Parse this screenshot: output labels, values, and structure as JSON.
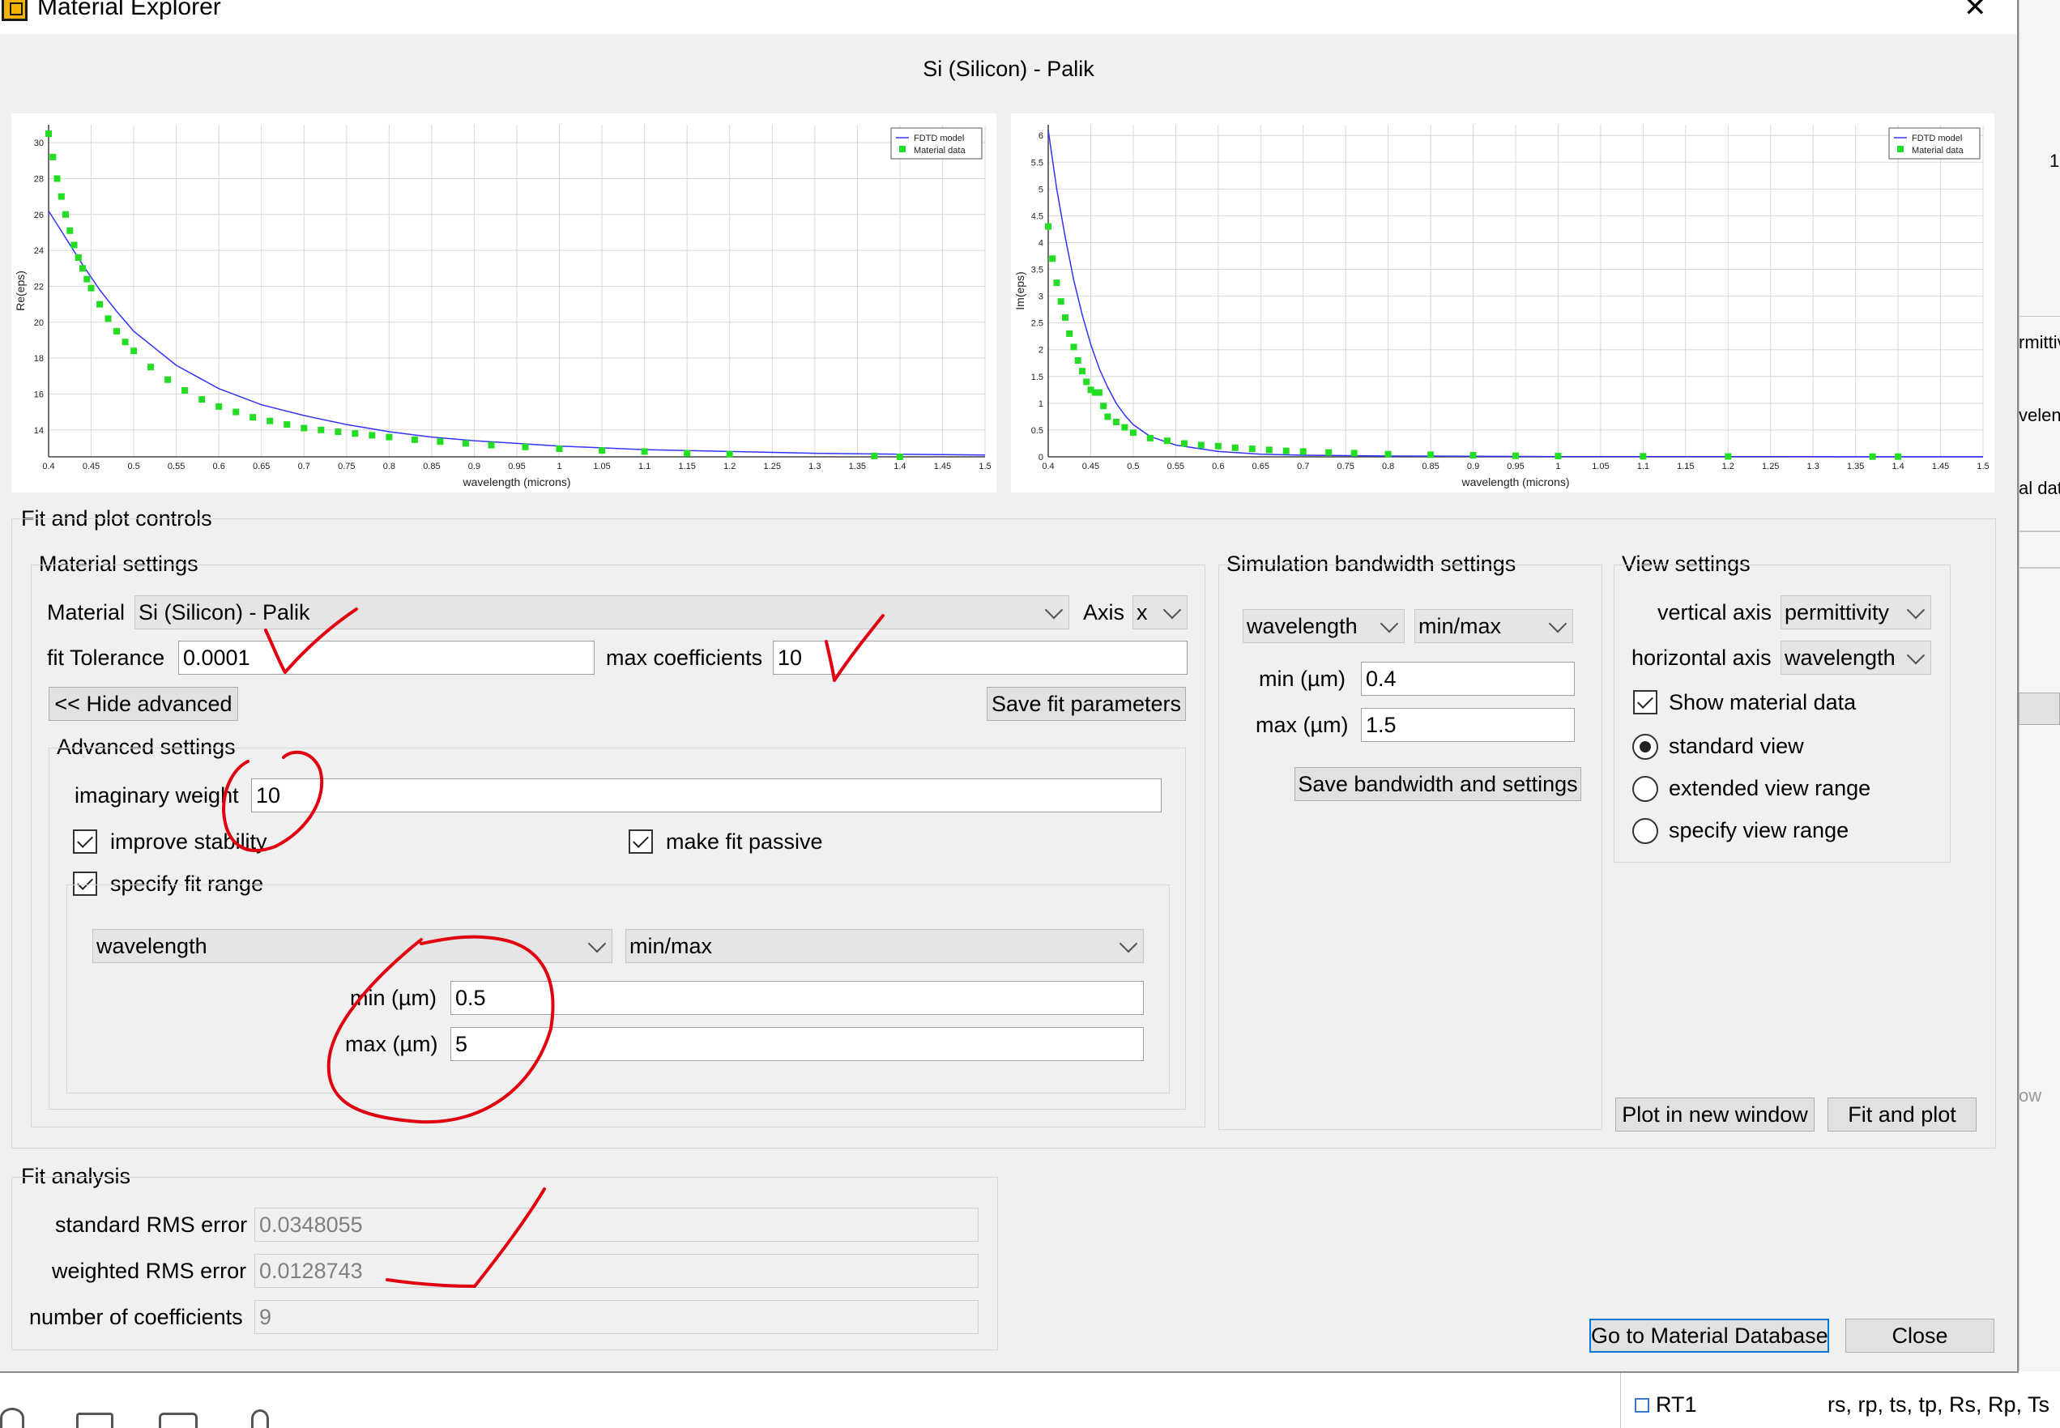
{
  "window": {
    "title": "Material Explorer",
    "close_glyph": "✕",
    "icon": "app-icon"
  },
  "plot_header": "Si (Silicon) - Palik",
  "charts": {
    "left": {
      "ylabel": "Re(eps)",
      "xlabel": "wavelength (microns)",
      "legend": [
        "FDTD model",
        "Material data"
      ],
      "yticks": [
        "14",
        "16",
        "18",
        "20",
        "22",
        "24",
        "26",
        "28",
        "30"
      ]
    },
    "right": {
      "ylabel": "Im(eps)",
      "xlabel": "wavelength (microns)",
      "legend": [
        "FDTD model",
        "Material data"
      ],
      "yticks": [
        "0",
        "0.5",
        "1",
        "1.5",
        "2",
        "2.5",
        "3",
        "3.5",
        "4",
        "4.5",
        "5",
        "5.5",
        "6"
      ]
    },
    "xticks": [
      "0.4",
      "0.45",
      "0.5",
      "0.55",
      "0.6",
      "0.65",
      "0.7",
      "0.75",
      "0.8",
      "0.85",
      "0.9",
      "0.95",
      "1",
      "1.05",
      "1.1",
      "1.15",
      "1.2",
      "1.25",
      "1.3",
      "1.35",
      "1.4",
      "1.45",
      "1.5"
    ]
  },
  "chart_data": [
    {
      "type": "line",
      "title": "",
      "xlabel": "wavelength (microns)",
      "ylabel": "Re(eps)",
      "xlim": [
        0.4,
        1.5
      ],
      "ylim": [
        12.5,
        31
      ],
      "grid": true,
      "legend_position": "top-right",
      "colors": {
        "model": "#3333ff",
        "data": "#22dd22"
      },
      "series": [
        {
          "name": "FDTD model",
          "style": "line",
          "x": [
            0.4,
            0.42,
            0.44,
            0.46,
            0.48,
            0.5,
            0.55,
            0.6,
            0.65,
            0.7,
            0.75,
            0.8,
            0.85,
            0.9,
            0.95,
            1.0,
            1.05,
            1.1,
            1.15,
            1.2,
            1.25,
            1.3,
            1.35,
            1.4,
            1.45,
            1.5
          ],
          "y": [
            26.2,
            24.7,
            23.2,
            21.8,
            20.6,
            19.5,
            17.6,
            16.3,
            15.4,
            14.8,
            14.3,
            13.9,
            13.6,
            13.4,
            13.25,
            13.1,
            13.0,
            12.9,
            12.85,
            12.8,
            12.75,
            12.7,
            12.67,
            12.65,
            12.62,
            12.6
          ]
        },
        {
          "name": "Material data",
          "style": "markers",
          "x": [
            0.4,
            0.405,
            0.41,
            0.415,
            0.42,
            0.425,
            0.43,
            0.435,
            0.44,
            0.445,
            0.45,
            0.46,
            0.47,
            0.48,
            0.49,
            0.5,
            0.52,
            0.54,
            0.56,
            0.58,
            0.6,
            0.62,
            0.64,
            0.66,
            0.68,
            0.7,
            0.72,
            0.74,
            0.76,
            0.78,
            0.8,
            0.83,
            0.86,
            0.89,
            0.92,
            0.96,
            1.0,
            1.05,
            1.1,
            1.15,
            1.2,
            1.37,
            1.4
          ],
          "y": [
            30.5,
            29.2,
            28.0,
            27.0,
            26.0,
            25.1,
            24.3,
            23.6,
            23.0,
            22.4,
            21.9,
            21.0,
            20.2,
            19.5,
            18.9,
            18.4,
            17.5,
            16.8,
            16.2,
            15.7,
            15.3,
            15.0,
            14.7,
            14.5,
            14.3,
            14.1,
            14.0,
            13.9,
            13.8,
            13.7,
            13.6,
            13.45,
            13.35,
            13.25,
            13.15,
            13.05,
            12.95,
            12.85,
            12.8,
            12.7,
            12.65,
            12.55,
            12.5
          ]
        }
      ]
    },
    {
      "type": "line",
      "title": "",
      "xlabel": "wavelength (microns)",
      "ylabel": "Im(eps)",
      "xlim": [
        0.4,
        1.5
      ],
      "ylim": [
        0,
        6.2
      ],
      "grid": true,
      "legend_position": "top-right",
      "colors": {
        "model": "#3333ff",
        "data": "#22dd22"
      },
      "series": [
        {
          "name": "FDTD model",
          "style": "line",
          "x": [
            0.4,
            0.41,
            0.42,
            0.43,
            0.44,
            0.45,
            0.46,
            0.47,
            0.48,
            0.49,
            0.5,
            0.52,
            0.55,
            0.6,
            0.65,
            0.7,
            0.8,
            0.9,
            1.0,
            1.2,
            1.5
          ],
          "y": [
            6.1,
            5.0,
            4.1,
            3.3,
            2.65,
            2.1,
            1.65,
            1.3,
            1.0,
            0.78,
            0.6,
            0.38,
            0.22,
            0.1,
            0.05,
            0.03,
            0.015,
            0.01,
            0.005,
            0.003,
            0.002
          ]
        },
        {
          "name": "Material data",
          "style": "markers",
          "x": [
            0.4,
            0.405,
            0.41,
            0.415,
            0.42,
            0.425,
            0.43,
            0.435,
            0.44,
            0.445,
            0.45,
            0.455,
            0.46,
            0.465,
            0.47,
            0.48,
            0.49,
            0.5,
            0.52,
            0.54,
            0.56,
            0.58,
            0.6,
            0.62,
            0.64,
            0.66,
            0.68,
            0.7,
            0.73,
            0.76,
            0.8,
            0.85,
            0.9,
            0.95,
            1.0,
            1.1,
            1.2,
            1.37,
            1.4
          ],
          "y": [
            4.3,
            3.7,
            3.25,
            2.9,
            2.6,
            2.3,
            2.05,
            1.8,
            1.6,
            1.4,
            1.25,
            1.2,
            1.2,
            0.95,
            0.75,
            0.65,
            0.55,
            0.45,
            0.35,
            0.3,
            0.25,
            0.22,
            0.2,
            0.17,
            0.15,
            0.13,
            0.11,
            0.1,
            0.08,
            0.07,
            0.05,
            0.04,
            0.03,
            0.02,
            0.015,
            0.01,
            0.008,
            0.005,
            0.004
          ]
        }
      ]
    }
  ],
  "fit_controls": {
    "title": "Fit and plot controls",
    "material_settings": {
      "title": "Material settings",
      "material_label": "Material",
      "material_value": "Si (Silicon) - Palik",
      "axis_label": "Axis",
      "axis_value": "x",
      "fit_tolerance_label": "fit Tolerance",
      "fit_tolerance_value": "0.0001",
      "max_coefficients_label": "max coefficients",
      "max_coefficients_value": "10",
      "hide_advanced_label": "<< Hide advanced",
      "save_fit_label": "Save fit parameters"
    },
    "advanced": {
      "title": "Advanced settings",
      "imaginary_weight_label": "imaginary weight",
      "imaginary_weight_value": "10",
      "improve_stability_label": "improve stability",
      "improve_stability_checked": true,
      "make_fit_passive_label": "make fit passive",
      "make_fit_passive_checked": true,
      "specify_fit_range_label": "specify fit range",
      "specify_fit_range_checked": true,
      "range_quantity": "wavelength",
      "range_mode": "min/max",
      "min_label": "min (µm)",
      "min_value": "0.5",
      "max_label": "max (µm)",
      "max_value": "5"
    },
    "simulation": {
      "title": "Simulation bandwidth settings",
      "quantity": "wavelength",
      "mode": "min/max",
      "min_label": "min (µm)",
      "min_value": "0.4",
      "max_label": "max (µm)",
      "max_value": "1.5",
      "save_label": "Save bandwidth and settings"
    },
    "view": {
      "title": "View settings",
      "vertical_axis_label": "vertical axis",
      "vertical_axis_value": "permittivity",
      "horizontal_axis_label": "horizontal axis",
      "horizontal_axis_value": "wavelength",
      "show_material_data_label": "Show material data",
      "show_material_data_checked": true,
      "standard_view_label": "standard view",
      "extended_view_label": "extended view range",
      "specify_view_label": "specify view range",
      "selected_view": "standard view"
    },
    "plot_new_window_label": "Plot in new window",
    "fit_and_plot_label": "Fit and plot"
  },
  "fit_analysis": {
    "title": "Fit analysis",
    "standard_rms_label": "standard RMS error",
    "standard_rms_value": "0.0348055",
    "weighted_rms_label": "weighted RMS error",
    "weighted_rms_value": "0.0128743",
    "num_coeff_label": "number of coefficients",
    "num_coeff_value": "9"
  },
  "footer": {
    "go_to_db_label": "Go to Material Database",
    "close_label": "Close"
  },
  "background": {
    "frag_1": "1",
    "frag_2": "rmittivit",
    "frag_3": "velengt",
    "frag_4": "al data",
    "frag_5": "ow",
    "rt_label": "RT1",
    "rt_value": "rs, rp, ts, tp, Rs, Rp, Ts"
  },
  "annotation_color": "#e0000f"
}
